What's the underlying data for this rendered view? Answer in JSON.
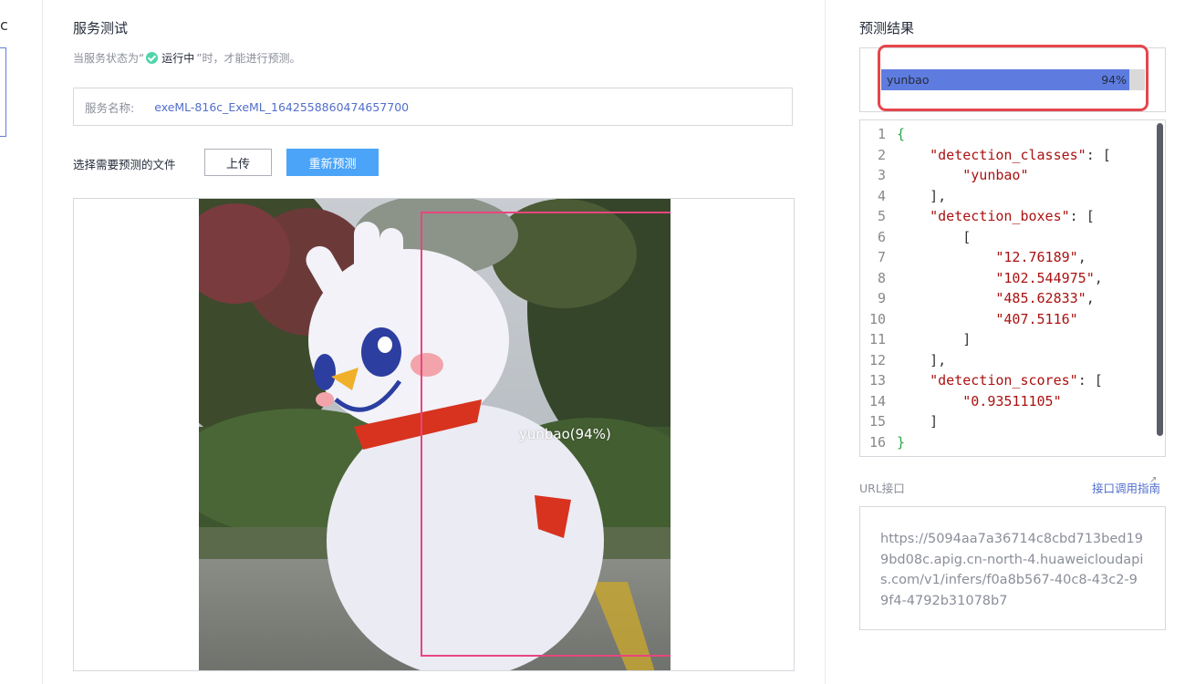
{
  "left_panel": {
    "partial_letter": "c"
  },
  "test": {
    "title": "服务测试",
    "hint_prefix": "当服务状态为“",
    "hint_status": "运行中",
    "hint_suffix": "”时，才能进行预测。",
    "service_label": "服务名称:",
    "service_name": "exeML-816c_ExeML_1642558860474657700",
    "choose_file_label": "选择需要预测的文件",
    "upload_button": "上传",
    "repredict_button": "重新预测",
    "detection_label": "yunbao(94%)"
  },
  "result": {
    "title": "预测结果",
    "bar_name": "yunbao",
    "bar_pct_text": "94%",
    "bar_fraction": 0.94,
    "line_numbers": [
      "1",
      "2",
      "3",
      "4",
      "5",
      "6",
      "7",
      "8",
      "9",
      "10",
      "11",
      "12",
      "13",
      "14",
      "15",
      "16"
    ],
    "json_keys": {
      "detection_classes": "\"detection_classes\"",
      "detection_boxes": "\"detection_boxes\"",
      "detection_scores": "\"detection_scores\""
    },
    "classes": [
      "\"yunbao\""
    ],
    "boxes": [
      "\"12.76189\"",
      "\"102.544975\"",
      "\"485.62833\"",
      "\"407.5116\""
    ],
    "scores": [
      "\"0.93511105\""
    ]
  },
  "url": {
    "label": "URL接口",
    "guide_link": "接口调用指南",
    "value": "https://5094aa7a36714c8cbd713bed199bd08c.apig.cn-north-4.huaweicloudapis.com/v1/infers/f0a8b567-40c8-43c2-99f4-4792b31078b7"
  },
  "colors": {
    "accent_blue": "#5e7ce0",
    "primary_button": "#4ba4f7",
    "status_green": "#50d4ab",
    "highlight_red": "#e5464c",
    "bbox_pink": "#e8457f"
  }
}
